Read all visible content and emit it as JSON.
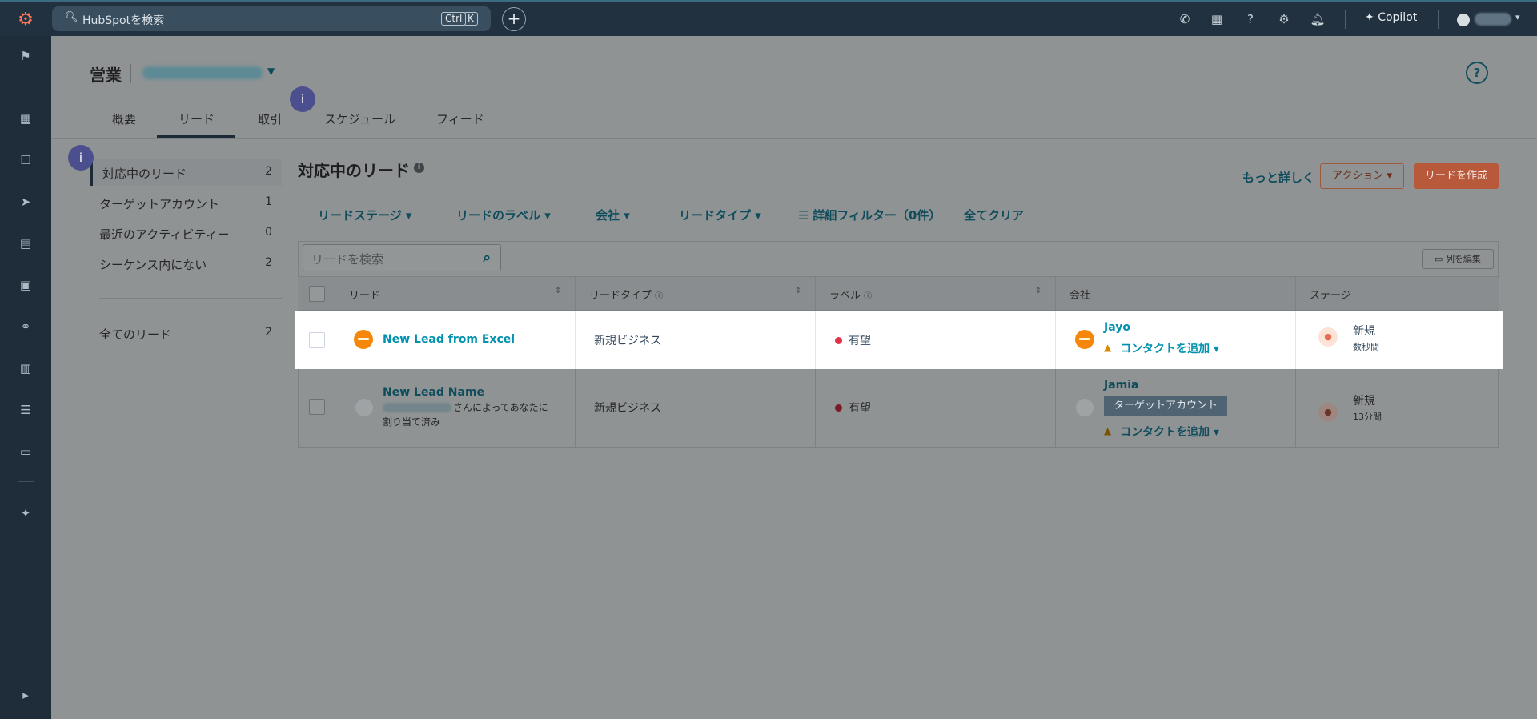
{
  "topbar": {
    "search_placeholder": "HubSpotを検索",
    "shortcut_ctrl": "Ctrl",
    "shortcut_k": "K",
    "plus": "+",
    "copilot_label": "Copilot"
  },
  "header": {
    "app_title": "営業",
    "help": "?"
  },
  "tabs": [
    {
      "label": "概要"
    },
    {
      "label": "リード"
    },
    {
      "label": "取引"
    },
    {
      "label": "スケジュール"
    },
    {
      "label": "フィード"
    }
  ],
  "info_bubble": "i",
  "sidebar": {
    "items": [
      {
        "label": "対応中のリード",
        "count": "2"
      },
      {
        "label": "ターゲットアカウント",
        "count": "1"
      },
      {
        "label": "最近のアクティビティー",
        "count": "0"
      },
      {
        "label": "シーケンス内にない",
        "count": "2"
      }
    ],
    "all": {
      "label": "全てのリード",
      "count": "2"
    }
  },
  "content": {
    "title": "対応中のリード",
    "info": "i",
    "more_link": "もっと詳しく",
    "action_button": "アクション ▾",
    "create_button": "リードを作成"
  },
  "filters": [
    {
      "label": "リードステージ ▾"
    },
    {
      "label": "リードのラベル ▾"
    },
    {
      "label": "会社 ▾"
    },
    {
      "label": "リードタイプ ▾"
    },
    {
      "label": "詳細フィルター（0件）"
    },
    {
      "label": "全てクリア"
    }
  ],
  "table": {
    "search_placeholder": "リードを検索",
    "edit_columns": "列を編集",
    "columns": [
      "リード",
      "リードタイプ",
      "ラベル",
      "会社",
      "ステージ"
    ],
    "rows": [
      {
        "lead_name": "New Lead from Excel",
        "lead_type": "新規ビジネス",
        "label": "有望",
        "company": "Jayo",
        "contact_link": "コンタクトを追加 ▾",
        "stage": "新規",
        "stage_time": "数秒間"
      },
      {
        "lead_name": "New Lead Name",
        "assigned_suffix": "さんによってあなたに",
        "assigned_line2": "割り当て済み",
        "lead_type": "新規ビジネス",
        "label": "有望",
        "company": "Jamia",
        "company_tag": "ターゲットアカウント",
        "contact_link": "コンタクトを追加 ▾",
        "stage": "新規",
        "stage_time": "13分間"
      }
    ]
  },
  "icons": {
    "search": "search-icon",
    "phone": "phone-icon",
    "marketplace": "marketplace-icon",
    "help": "help-icon",
    "settings": "gear-icon",
    "notifications": "bell-icon"
  }
}
